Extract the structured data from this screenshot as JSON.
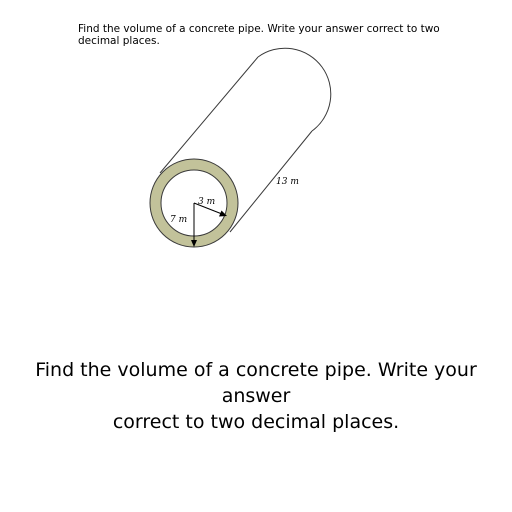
{
  "question": {
    "small_line1": "Find the volume of a concrete pipe. Write your answer correct to two",
    "small_line2": "decimal places.",
    "large_line1": "Find the volume of a concrete pipe. Write your answer",
    "large_line2": "correct to two decimal places."
  },
  "figure": {
    "length_label": "13 m",
    "inner_radius_label": "3 m",
    "outer_radius_label": "7 m",
    "concrete_color": "#c2c29a",
    "outline_color": "#3a3a3a"
  }
}
